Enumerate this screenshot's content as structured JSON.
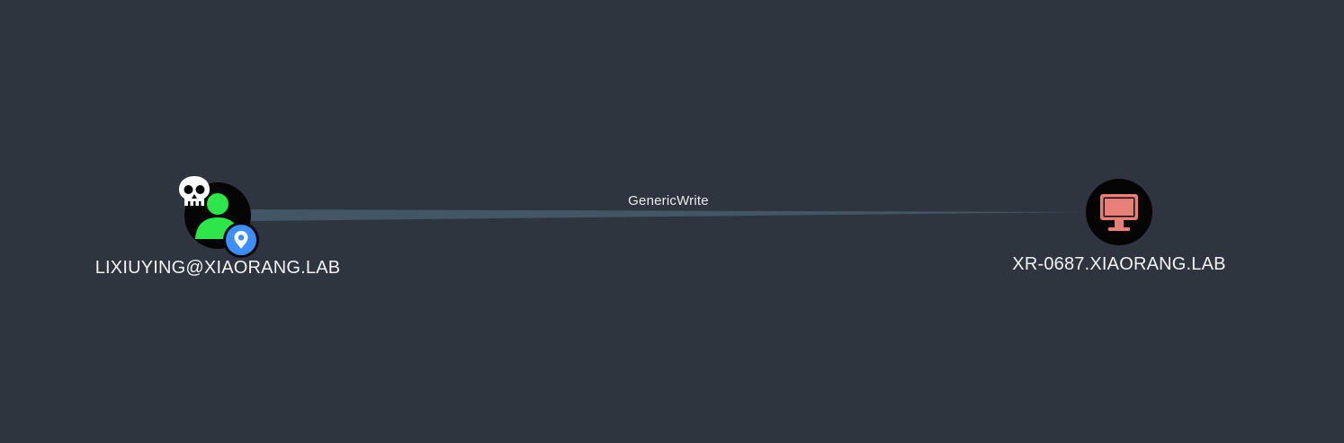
{
  "graph": {
    "edge": {
      "label": "GenericWrite"
    },
    "source_node": {
      "label": "LIXIUYING@XIAORANG.LAB",
      "type_icon": "user-icon",
      "badges": [
        "skull-icon",
        "map-pin-icon"
      ]
    },
    "target_node": {
      "label": "XR-0687.XIAORANG.LAB",
      "type_icon": "computer-icon"
    }
  },
  "colors": {
    "background": "#2f353e",
    "user_icon": "#2ee64a",
    "computer_icon": "#e87f78",
    "pin_badge": "#3e8eff",
    "edge": "#435867",
    "text": "#f1f3f5"
  }
}
